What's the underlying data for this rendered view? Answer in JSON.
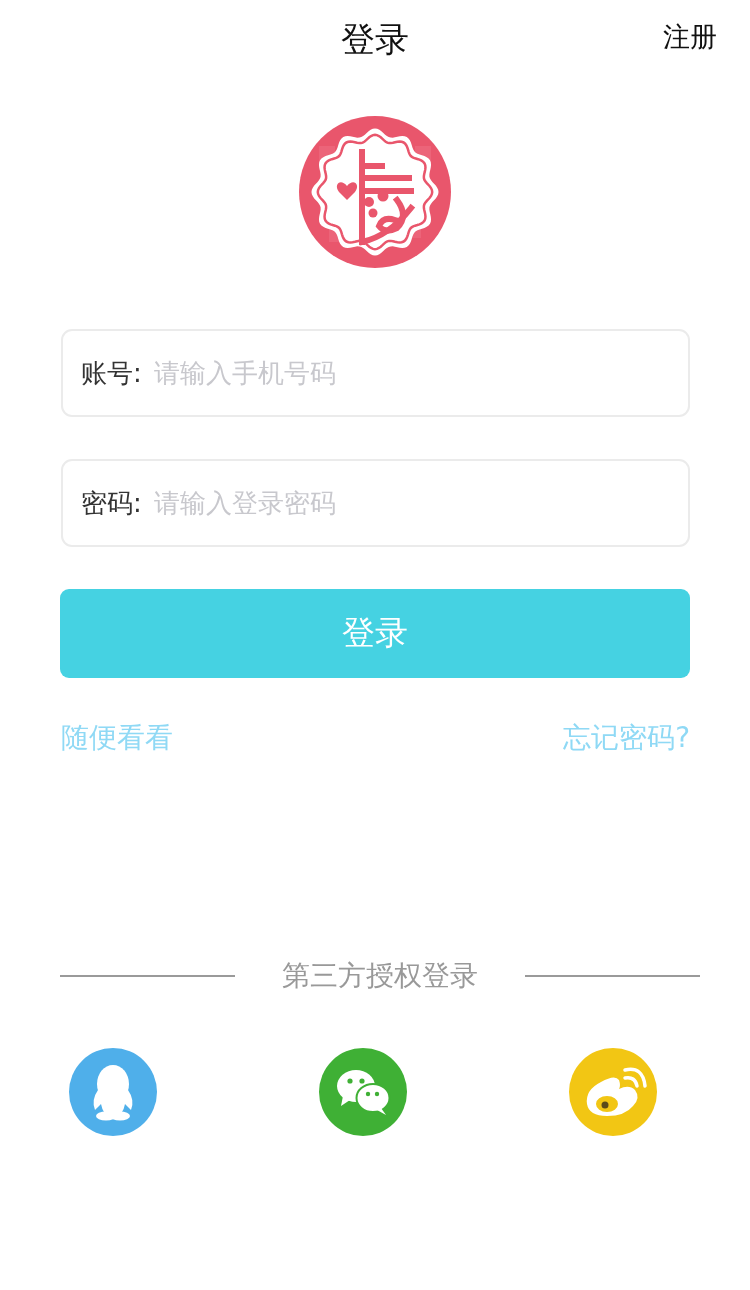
{
  "header": {
    "title": "登录",
    "action": "注册"
  },
  "fields": [
    {
      "label": "账号:",
      "placeholder": "请输入手机号码"
    },
    {
      "label": "密码:",
      "placeholder": "请输入登录密码"
    }
  ],
  "login_button": "登录",
  "links": {
    "browse": "随便看看",
    "forgot": "忘记密码?"
  },
  "third_party": {
    "title": "第三方授权登录",
    "providers": [
      {
        "kind": "qq",
        "color": "#4fafea"
      },
      {
        "kind": "wechat",
        "color": "#3fb035"
      },
      {
        "kind": "weibo",
        "color": "#f2c614"
      }
    ]
  }
}
